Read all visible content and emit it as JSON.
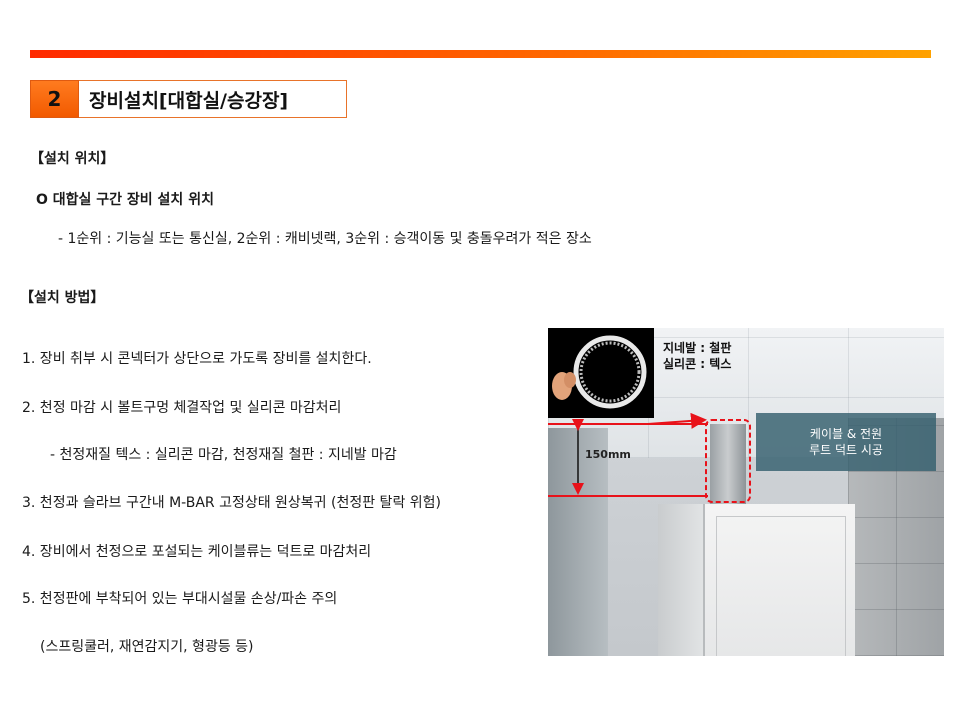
{
  "header": {
    "section_number": "2",
    "section_title": "장비설치[대합실/승강장]"
  },
  "install_location": {
    "heading": "【설치 위치】",
    "subheading": "O 대합실 구간 장비 설치 위치",
    "priority_line": "- 1순위 : 기능실 또는 통신실,  2순위 : 캐비넷랙,  3순위 : 승객이동 및 충돌우려가 적은 장소"
  },
  "install_method": {
    "heading": "【설치 방법】",
    "steps": [
      "1. 장비 취부 시 콘넥터가 상단으로 가도록 장비를 설치한다.",
      "2. 천정 마감 시 볼트구멍 체결작업 및 실리콘 마감처리",
      "- 천정재질 텍스 : 실리콘 마감, 천정재질 철판 : 지네발 마감",
      "3. 천정과 슬라브 구간내 M-BAR 고정상태 원상복귀 (천정판 탈락 위험)",
      "4. 장비에서 천정으로 포설되는 케이블류는 덕트로 마감처리",
      "5. 천정판에 부착되어 있는 부대시설물 손상/파손 주의",
      "(스프링쿨러, 재연감지기, 형광등 등)"
    ]
  },
  "photo": {
    "inset_label_1": "지네발 : 철판",
    "inset_label_2": "실리콘 : 텍스",
    "callout_line_1": "케이블 & 전원",
    "callout_line_2": "루트 덕트 시공",
    "dimension": "150mm"
  },
  "colors": {
    "accent_orange": "#f25a00",
    "marker_red": "#e8121a",
    "callout_teal": "#345f6e"
  }
}
